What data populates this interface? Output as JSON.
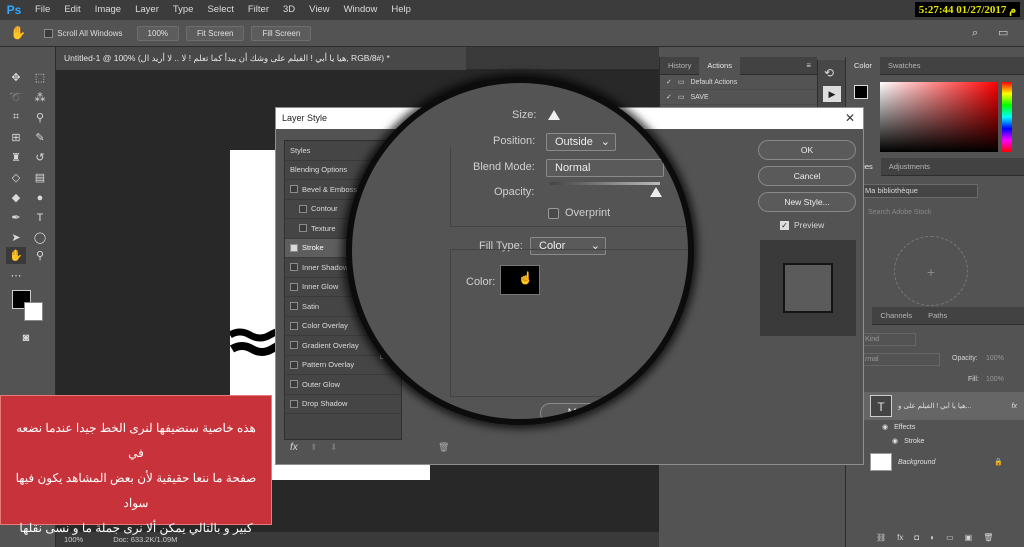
{
  "app": {
    "logo": "Ps",
    "clock": "5:27:44 01/27/2017 م"
  },
  "menu": [
    "File",
    "Edit",
    "Image",
    "Layer",
    "Type",
    "Select",
    "Filter",
    "3D",
    "View",
    "Window",
    "Help"
  ],
  "options": {
    "scroll_all": "Scroll All Windows",
    "zoom": "100%",
    "fit_screen": "Fit Screen",
    "fill_screen": "Fill Screen"
  },
  "document": {
    "tab_title": "Untitled-1 @ 100% (هيا يا أبي ! الفيلم على وشك أن يبدأ كما تعلم ! لا .. لا أريد ال, RGB/8#) *",
    "status_zoom": "100%",
    "status_doc": "Doc: 633.2K/1.09M"
  },
  "history_panel": {
    "tabs": [
      "History",
      "Actions"
    ],
    "rows": [
      "Default Actions",
      "SAVE"
    ]
  },
  "color_panel": {
    "tabs": [
      "Color",
      "Swatches"
    ]
  },
  "libraries_panel": {
    "tabs": [
      "raries",
      "Adjustments"
    ],
    "library": "Ma bibliothèque",
    "search": "Search Adobe Stock"
  },
  "layers_panel": {
    "tabs": [
      "ers",
      "Channels",
      "Paths"
    ],
    "kind": "Kind",
    "mode": "rmal",
    "opacity_label": "Opacity:",
    "opacity": "100%",
    "fill_label": "Fill:",
    "fill": "100%",
    "text_layer": "هيا يا أبي ! الفيلم على و...",
    "effects": "Effects",
    "stroke": "Stroke",
    "background": "Background"
  },
  "dialog": {
    "title": "Layer Style",
    "styles": [
      {
        "label": "Styles",
        "check": false,
        "indent": false,
        "box": false
      },
      {
        "label": "Blending Options",
        "check": false,
        "indent": false,
        "box": false
      },
      {
        "label": "Bevel & Emboss",
        "check": false,
        "indent": false,
        "box": true
      },
      {
        "label": "Contour",
        "check": false,
        "indent": true,
        "box": true
      },
      {
        "label": "Texture",
        "check": false,
        "indent": true,
        "box": true
      },
      {
        "label": "Stroke",
        "check": true,
        "indent": false,
        "box": true
      },
      {
        "label": "Inner Shadow",
        "check": false,
        "indent": false,
        "box": true
      },
      {
        "label": "Inner Glow",
        "check": false,
        "indent": false,
        "box": true
      },
      {
        "label": "Satin",
        "check": false,
        "indent": false,
        "box": true
      },
      {
        "label": "Color Overlay",
        "check": false,
        "indent": false,
        "box": true
      },
      {
        "label": "Gradient Overlay",
        "check": false,
        "indent": false,
        "box": true
      },
      {
        "label": "Pattern Overlay",
        "check": false,
        "indent": false,
        "box": true
      },
      {
        "label": "Outer Glow",
        "check": false,
        "indent": false,
        "box": true
      },
      {
        "label": "Drop Shadow",
        "check": false,
        "indent": false,
        "box": true
      }
    ],
    "fx": "fx",
    "ok": "OK",
    "cancel": "Cancel",
    "new_style": "New Style...",
    "preview": "Preview"
  },
  "stroke": {
    "size_label": "Size:",
    "position_label": "Position:",
    "position": "Outside",
    "blend_label": "Blend Mode:",
    "blend": "Normal",
    "opacity_label": "Opacity:",
    "overprint": "Overprint",
    "fill_type_label": "Fill Type:",
    "fill_type": "Color",
    "color_label": "Color:",
    "make_default": "Make Default",
    "color_hex": "#000000"
  },
  "overlay_text": [
    "هذه خاصية سنضيفها لنرى الخط جيدا عندما نضعه في",
    "صفحة ما ننعا حقيقية لأن بعض المشاهد يكون فيها سواد",
    "كبير و بالتالي يمكن ألا نرى جملة ما و نسى نقلها"
  ]
}
